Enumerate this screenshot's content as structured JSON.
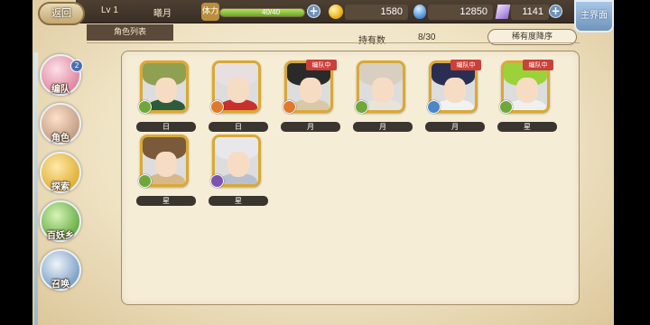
{
  "header": {
    "back_label": "返回",
    "level": "Lv 1",
    "player_name": "曦月",
    "stamina_label": "体力",
    "stamina_text": "40/40",
    "stamina_fraction": 1.0,
    "coin": "1580",
    "jade": "12850",
    "crystal": "1141",
    "main_label": "主界面",
    "plus": "+"
  },
  "tabs": {
    "list": "角色列表"
  },
  "roster_header": {
    "owned_label": "持有数",
    "owned_count": "8/30",
    "sort_label": "稀有度降序"
  },
  "nav": {
    "items": [
      {
        "label": "编队",
        "badge": "2"
      },
      {
        "label": "角色"
      },
      {
        "label": "探索"
      },
      {
        "label": "百妖乡"
      },
      {
        "label": "召唤"
      }
    ]
  },
  "characters": [
    {
      "name": "日",
      "in_team": false,
      "tag": "",
      "element": "wind",
      "element_color": "#6ea83a",
      "hair": "#8fa052",
      "body": "#2d5c3a"
    },
    {
      "name": "日",
      "in_team": false,
      "tag": "",
      "element": "fire",
      "element_color": "#e07a2a",
      "hair": "#e8e0e0",
      "body": "#c83030"
    },
    {
      "name": "月",
      "in_team": true,
      "tag": "编队中",
      "element": "fire",
      "element_color": "#e07a2a",
      "hair": "#2a2a2a",
      "body": "#d8c8a8"
    },
    {
      "name": "月",
      "in_team": false,
      "tag": "",
      "element": "wind",
      "element_color": "#6ea83a",
      "hair": "#d8cfc0",
      "body": "#e8e4dc"
    },
    {
      "name": "月",
      "in_team": true,
      "tag": "编队中",
      "element": "water",
      "element_color": "#4a86c8",
      "hair": "#2a2f52",
      "body": "#f2f2f2"
    },
    {
      "name": "星",
      "in_team": true,
      "tag": "编队中",
      "element": "wind",
      "element_color": "#6ea83a",
      "hair": "#9bd23a",
      "body": "#f0f0f0"
    },
    {
      "name": "星",
      "in_team": false,
      "tag": "",
      "element": "wind",
      "element_color": "#6ea83a",
      "hair": "#7a5a3a",
      "body": "#d8b888"
    },
    {
      "name": "星",
      "in_team": false,
      "tag": "",
      "element": "dark",
      "element_color": "#7a52b0",
      "hair": "#e8e8ec",
      "body": "#b8c0d0"
    }
  ],
  "colors": {
    "accent_gold": "#d9a935",
    "team_tag": "#c9413a",
    "panel_bg": "#f6edd7"
  }
}
